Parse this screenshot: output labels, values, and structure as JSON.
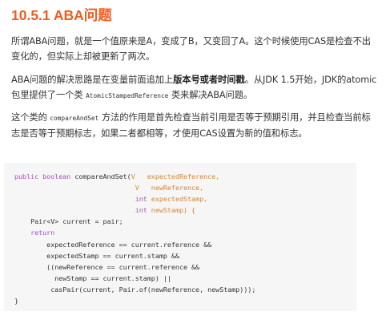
{
  "heading": "10.5.1 ABA问题",
  "paragraphs": {
    "p1": "所谓ABA问题，就是一个值原来是A，变成了B，又变回了A。这个时候使用CAS是检查不出变化的，但实际上却被更新了两次。",
    "p2_before": "ABA问题的解决思路是在变量前面追加上",
    "p2_bold": "版本号或者时间戳",
    "p2_after": "。从JDK 1.5开始，JDK的atomic包里提供了一个类",
    "p2_code": "AtomicStampedReference",
    "p2_end": "类来解决ABA问题。",
    "p3_before": "这个类的",
    "p3_code": "compareAndSet",
    "p3_after": "方法的作用是首先检查当前引用是否等于预期引用，并且检查当前标志是否等于预期标志，如果二者都相等，才使用CAS设置为新的值和标志。"
  },
  "code": {
    "l1_kw": "public boolean",
    "l1_name": " compareAndSet(",
    "l1_type": "V",
    "l1_param": "   expectedReference,",
    "l2_indent": "                              ",
    "l2_type": "V",
    "l2_param": "   newReference,",
    "l3_indent": "                              ",
    "l3_type": "int",
    "l3_param": " expectedStamp,",
    "l4_indent": "                              ",
    "l4_type": "int",
    "l4_param": " newStamp) {",
    "l5": "    Pair<V> current = pair;",
    "l6_indent": "    ",
    "l6_kw": "return",
    "l7": "        expectedReference == current.reference &&",
    "l8": "        expectedStamp == current.stamp &&",
    "l9": "        ((newReference == current.reference &&",
    "l10": "          newStamp == current.stamp) ||",
    "l11": "         casPair(current, Pair.of(newReference, newStamp)));",
    "l12": "}"
  }
}
